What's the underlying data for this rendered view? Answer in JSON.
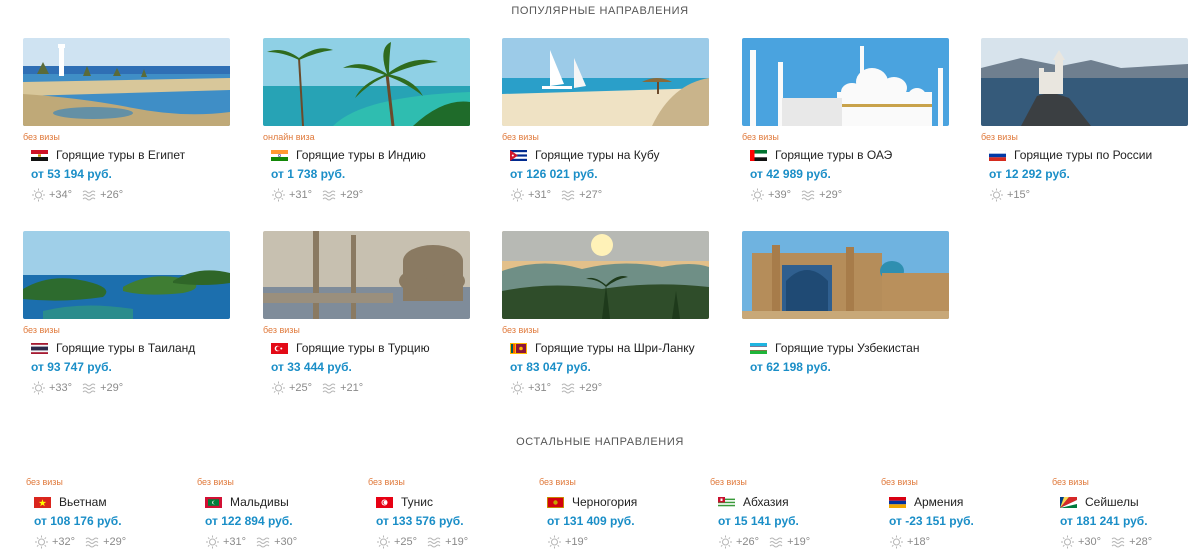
{
  "sections": {
    "popular_title": "ПОПУЛЯРНЫЕ НАПРАВЛЕНИЯ",
    "other_title": "ОСТАЛЬНЫЕ НАПРАВЛЕНИЯ"
  },
  "popular": [
    {
      "visa": "без визы",
      "name": "Горящие туры в Египет",
      "price": "от 53 194 руб.",
      "air": "+34°",
      "water": "+26°",
      "flag": "egypt",
      "scene": "beach-lighthouse"
    },
    {
      "visa": "онлайн виза",
      "name": "Горящие туры в Индию",
      "price": "от 1 738 руб.",
      "air": "+31°",
      "water": "+29°",
      "flag": "india",
      "scene": "palm-lagoon"
    },
    {
      "visa": "без визы",
      "name": "Горящие туры на Кубу",
      "price": "от 126 021 руб.",
      "air": "+31°",
      "water": "+27°",
      "flag": "cuba",
      "scene": "beach-boats"
    },
    {
      "visa": "без визы",
      "name": "Горящие туры в ОАЭ",
      "price": "от 42 989 руб.",
      "air": "+39°",
      "water": "+29°",
      "flag": "uae",
      "scene": "white-mosque"
    },
    {
      "visa": "без визы",
      "name": "Горящие туры по России",
      "price": "от 12 292 руб.",
      "air": "+15°",
      "water": "",
      "flag": "russia",
      "scene": "cliff-castle"
    },
    {
      "visa": "без визы",
      "name": "Горящие туры в Таиланд",
      "price": "от 93 747 руб.",
      "air": "+33°",
      "water": "+29°",
      "flag": "thailand",
      "scene": "islands"
    },
    {
      "visa": "без визы",
      "name": "Горящие туры в Турцию",
      "price": "от 33 444 руб.",
      "air": "+25°",
      "water": "+21°",
      "flag": "turkey",
      "scene": "istanbul-mosque"
    },
    {
      "visa": "без визы",
      "name": "Горящие туры на Шри-Ланку",
      "price": "от 83 047 руб.",
      "air": "+31°",
      "water": "+29°",
      "flag": "srilanka",
      "scene": "jungle-sunset"
    },
    {
      "visa": "",
      "name": "Горящие туры Узбекистан",
      "price": "от 62 198 руб.",
      "air": "",
      "water": "",
      "flag": "uzbekistan",
      "scene": "registan"
    }
  ],
  "other": [
    {
      "visa": "без визы",
      "name": "Вьетнам",
      "price": "от 108 176 руб.",
      "air": "+32°",
      "water": "+29°",
      "flag": "vietnam"
    },
    {
      "visa": "без визы",
      "name": "Мальдивы",
      "price": "от 122 894 руб.",
      "air": "+31°",
      "water": "+30°",
      "flag": "maldives"
    },
    {
      "visa": "без визы",
      "name": "Тунис",
      "price": "от 133 576 руб.",
      "air": "+25°",
      "water": "+19°",
      "flag": "tunisia"
    },
    {
      "visa": "без визы",
      "name": "Черногория",
      "price": "от 131 409 руб.",
      "air": "+19°",
      "water": "",
      "flag": "montenegro"
    },
    {
      "visa": "без визы",
      "name": "Абхазия",
      "price": "от 15 141 руб.",
      "air": "+26°",
      "water": "+19°",
      "flag": "abkhazia"
    },
    {
      "visa": "без визы",
      "name": "Армения",
      "price": "от -23 151 руб.",
      "air": "+18°",
      "water": "",
      "flag": "armenia"
    },
    {
      "visa": "без визы",
      "name": "Сейшелы",
      "price": "от 181 241 руб.",
      "air": "+30°",
      "water": "+28°",
      "flag": "seychelles"
    }
  ],
  "colors": {
    "price": "#1a8ec7",
    "visa": "#e07a3c",
    "weather": "#8a8a8a"
  }
}
